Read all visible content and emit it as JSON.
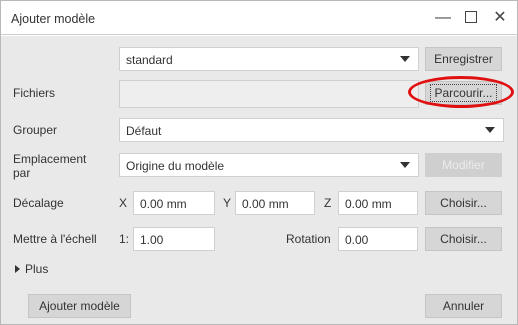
{
  "window": {
    "title": "Ajouter modèle",
    "minimize": "—",
    "close": "✕"
  },
  "row_template": {
    "value": "standard",
    "save_label": "Enregistrer"
  },
  "row_files": {
    "label": "Fichiers",
    "value": "",
    "browse_label": "Parcourir..."
  },
  "row_group": {
    "label": "Grouper",
    "value": "Défaut"
  },
  "row_location": {
    "label": "Emplacement\npar",
    "value": "Origine du modèle",
    "modify_label": "Modifier"
  },
  "row_offset": {
    "label": "Décalage",
    "x_label": "X",
    "x_value": "0.00 mm",
    "y_label": "Y",
    "y_value": "0.00 mm",
    "z_label": "Z",
    "z_value": "0.00 mm",
    "choose_label": "Choisir..."
  },
  "row_scale": {
    "label": "Mettre à l'échell",
    "scale_prefix": "1:",
    "scale_value": "1.00",
    "rotation_label": "Rotation",
    "rotation_value": "0.00",
    "choose_label": "Choisir..."
  },
  "more": {
    "label": "Plus"
  },
  "footer": {
    "add_label": "Ajouter modèle",
    "cancel_label": "Annuler"
  },
  "colors": {
    "highlight_circle": "#e01010",
    "dialog_bg": "#e9e9e9",
    "button_bg": "#d6d6d6"
  }
}
